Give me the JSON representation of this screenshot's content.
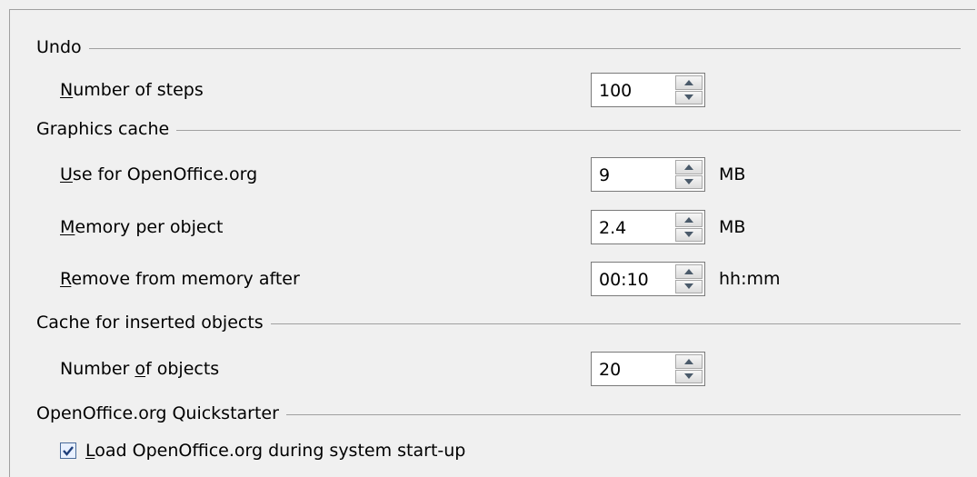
{
  "undo": {
    "title": "Undo",
    "steps": {
      "label_u": "N",
      "label_rest": "umber of steps",
      "value": "100"
    }
  },
  "graphics_cache": {
    "title": "Graphics cache",
    "use_for": {
      "label_u": "U",
      "label_rest": "se for OpenOffice.org",
      "value": "9",
      "unit": "MB"
    },
    "memory_per_object": {
      "label_u": "M",
      "label_rest": "emory per object",
      "value": "2.4",
      "unit": "MB"
    },
    "remove_after": {
      "label_u": "R",
      "label_rest": "emove from memory after",
      "value": "00:10",
      "unit": "hh:mm"
    }
  },
  "inserted_objects_cache": {
    "title": "Cache for inserted objects",
    "num_objects": {
      "label_pre": "Number ",
      "label_u": "o",
      "label_rest": "f objects",
      "value": "20"
    }
  },
  "quickstarter": {
    "title": "OpenOffice.org Quickstarter",
    "load": {
      "label_u": "L",
      "label_rest": "oad OpenOffice.org during system start-up",
      "checked": true
    }
  }
}
